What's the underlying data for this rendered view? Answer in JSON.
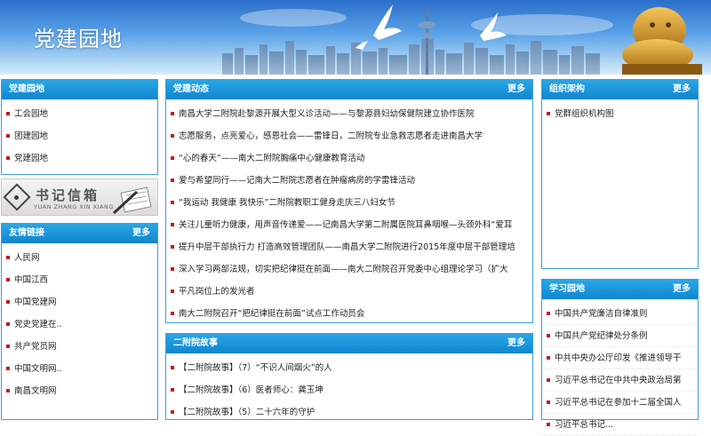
{
  "banner": {
    "title": "党建园地"
  },
  "left_top": {
    "header": "党建园地",
    "items": [
      "工会园地",
      "团建园地",
      "党建园地"
    ]
  },
  "mailbox": {
    "title": "书记信箱",
    "subtitle": "YUAN ZHANG XIN XIANG"
  },
  "links": {
    "header": "友情链接",
    "more": "更多",
    "items": [
      "人民网",
      "中国江西",
      "中国党建网",
      "党史党建在..",
      "共产党员网",
      "中国文明网..",
      "南昌文明网"
    ]
  },
  "news": {
    "header": "党建动态",
    "more": "更多",
    "items": [
      "南昌大学二附院赴黎源开展大型义诊活动——与黎源县妇幼保健院建立协作医院",
      "志愿服务，点亮爱心，感恩社会——雷锋日，二附院专业急救志愿者走进南昌大学",
      "“心的春天”——南大二附院胸痛中心健康教育活动",
      "爱与希望同行——记南大二附院志愿者在肿瘤病房的学雷锋活动",
      "“我运动 我健康 我快乐”二附院教职工健身走庆三八妇女节",
      "关注儿童听力健康，用声音传递爱——记南昌大学第二附属医院耳鼻咽喉—头颈外科“爱耳",
      "提升中层干部执行力 打造高效管理团队——南昌大学二附院进行2015年度中层干部管理培",
      "深入学习两部法规，切实把纪律挺在前面——南大二附院召开党委中心组理论学习（扩大",
      "平凡岗位上的发光者",
      "南大二附院召开“把纪律挺在前面”试点工作动员会"
    ]
  },
  "stories": {
    "header": "二附院故事",
    "more": "更多",
    "items": [
      "【二附院故事】（7）“不识人间烟火”的人",
      "【二附院故事】（6）医者师心：龚玉坤",
      "【二附院故事】（5）二十六年的守护"
    ]
  },
  "org": {
    "header": "组织架构",
    "more": "更多",
    "items": [
      "党群组织机构图"
    ]
  },
  "study": {
    "header": "学习园地",
    "more": "更多",
    "items": [
      "中国共产党廉洁自律准则",
      "中国共产党纪律处分条例",
      "中共中央办公厅印发《推进领导干",
      "习近平总书记在中共中央政治局第",
      "习近平总书记在参加十二届全国人",
      "习近平总书记..."
    ]
  },
  "colors": {
    "header_blue": "#1592d8",
    "bullet_red": "#c8161d",
    "border_blue": "#3aa0dc"
  }
}
